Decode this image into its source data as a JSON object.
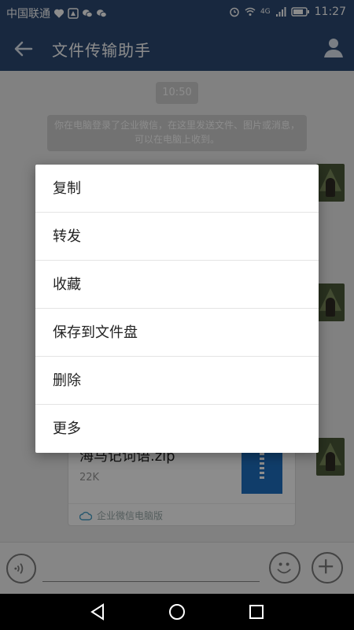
{
  "status_bar": {
    "carrier": "中国联通",
    "time": "11:27",
    "network": "4G"
  },
  "app_bar": {
    "title": "文件传输助手"
  },
  "chat": {
    "timestamp": "10:50",
    "system_notice": "你在电脑登录了企业微信，在这里发送文件、图片或消息，可以在电脑上收到。",
    "file_message": {
      "file_name": "海马记词语.zip",
      "file_size": "22K",
      "source": "企业微信电脑版"
    }
  },
  "context_menu": {
    "items": [
      {
        "label": "复制"
      },
      {
        "label": "转发"
      },
      {
        "label": "收藏"
      },
      {
        "label": "保存到文件盘"
      },
      {
        "label": "删除"
      },
      {
        "label": "更多"
      }
    ]
  },
  "input_bar": {
    "text_value": ""
  },
  "icons": {
    "back": "back-arrow-icon",
    "profile": "person-icon",
    "voice": "voice-icon",
    "emoji": "emoji-icon",
    "plus": "plus-icon",
    "nav_back": "triangle-back-icon",
    "nav_home": "circle-home-icon",
    "nav_recent": "square-recent-icon"
  },
  "colors": {
    "header": "#2c4a73",
    "menu_background": "#ffffff",
    "zip_icon": "#1e6fc2"
  }
}
